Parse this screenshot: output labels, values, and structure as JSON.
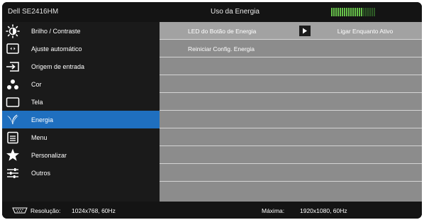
{
  "header": {
    "model": "Dell SE2416HM",
    "menu_title": "Uso da Energia",
    "energy_meter": {
      "segments_total": 21,
      "segments_active": 15,
      "active_color": "#67c14a",
      "inactive_color": "#2e5a26"
    }
  },
  "sidebar": {
    "items": [
      {
        "label": "Brilho / Contraste",
        "icon": "brightness-icon"
      },
      {
        "label": "Ajuste automático",
        "icon": "auto-adjust-icon"
      },
      {
        "label": "Origem de entrada",
        "icon": "input-source-icon"
      },
      {
        "label": "Cor",
        "icon": "color-icon"
      },
      {
        "label": "Tela",
        "icon": "display-icon"
      },
      {
        "label": "Energia",
        "icon": "energy-icon",
        "active": true
      },
      {
        "label": "Menu",
        "icon": "menu-icon"
      },
      {
        "label": "Personalizar",
        "icon": "star-icon"
      },
      {
        "label": "Outros",
        "icon": "sliders-icon"
      }
    ]
  },
  "content": {
    "rows": [
      {
        "label": "LED do Botão de Energia",
        "value": "Ligar Enquanto Ativo",
        "selected": true
      },
      {
        "label": "Reiniciar Config. Energia"
      }
    ]
  },
  "footer": {
    "resolution_label": "Resolução:",
    "resolution_value": "1024x768, 60Hz",
    "max_label": "Máxima:",
    "max_value": "1920x1080, 60Hz"
  },
  "colors": {
    "accent": "#1f6fbf",
    "content_bg": "#8c8c8c",
    "panel_bg": "#1a1a1a"
  }
}
